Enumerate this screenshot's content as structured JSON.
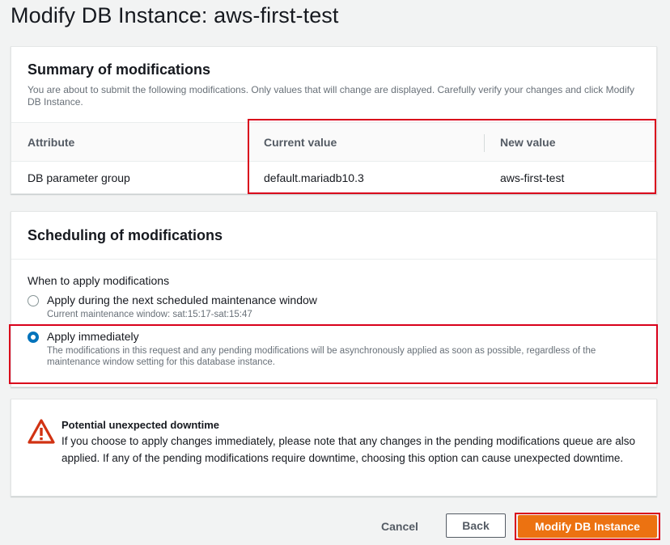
{
  "page": {
    "title": "Modify DB Instance: aws-first-test"
  },
  "summary": {
    "title": "Summary of modifications",
    "description": "You are about to submit the following modifications. Only values that will change are displayed. Carefully verify your changes and click Modify DB Instance.",
    "columns": [
      "Attribute",
      "Current value",
      "New value"
    ],
    "rows": [
      {
        "attribute": "DB parameter group",
        "current": "default.mariadb10.3",
        "new": "aws-first-test"
      }
    ]
  },
  "scheduling": {
    "title": "Scheduling of modifications",
    "field_label": "When to apply modifications",
    "options": [
      {
        "label": "Apply during the next scheduled maintenance window",
        "description": "Current maintenance window: sat:15:17-sat:15:47",
        "selected": false
      },
      {
        "label": "Apply immediately",
        "description": "The modifications in this request and any pending modifications will be asynchronously applied as soon as possible, regardless of the maintenance window setting for this database instance.",
        "selected": true
      }
    ]
  },
  "warning": {
    "icon": "warning-triangle-icon",
    "title": "Potential unexpected downtime",
    "body": "If you choose to apply changes immediately, please note that any changes in the pending modifications queue are also applied. If any of the pending modifications require downtime, choosing this option can cause unexpected downtime."
  },
  "actions": {
    "cancel": "Cancel",
    "back": "Back",
    "submit": "Modify DB Instance"
  },
  "colors": {
    "primary": "#ec7211",
    "highlight": "#d9001b",
    "radio_selected": "#0073bb",
    "warning_icon": "#d13212"
  }
}
